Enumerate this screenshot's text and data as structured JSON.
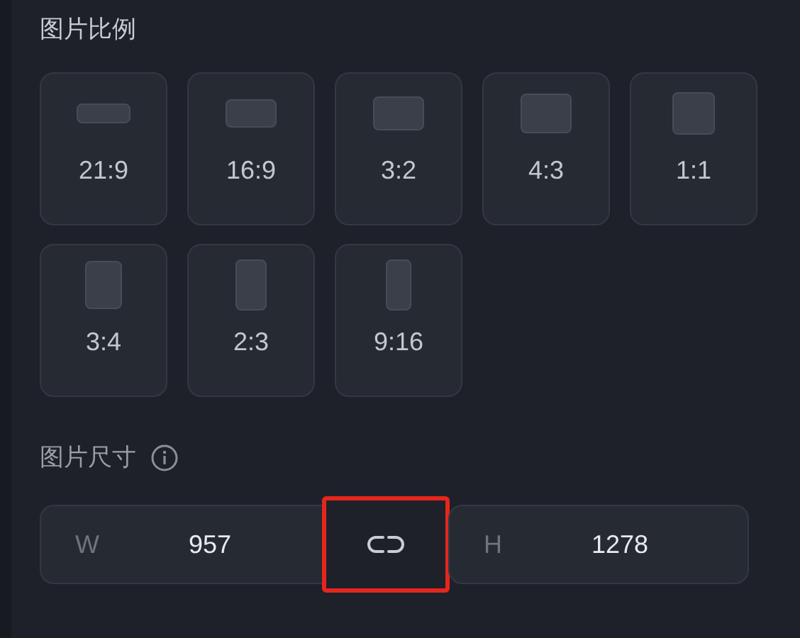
{
  "ratio_section": {
    "title": "图片比例",
    "presets": [
      {
        "label": "21:9",
        "selected": false
      },
      {
        "label": "16:9",
        "selected": false
      },
      {
        "label": "3:2",
        "selected": false
      },
      {
        "label": "4:3",
        "selected": false
      },
      {
        "label": "1:1",
        "selected": false
      },
      {
        "label": "3:4",
        "selected": false
      },
      {
        "label": "2:3",
        "selected": false
      },
      {
        "label": "9:16",
        "selected": false
      }
    ]
  },
  "size_section": {
    "title": "图片尺寸",
    "width": {
      "prefix": "W",
      "value": "957"
    },
    "link": {
      "highlighted": true
    },
    "height": {
      "prefix": "H",
      "value": "1278"
    }
  }
}
